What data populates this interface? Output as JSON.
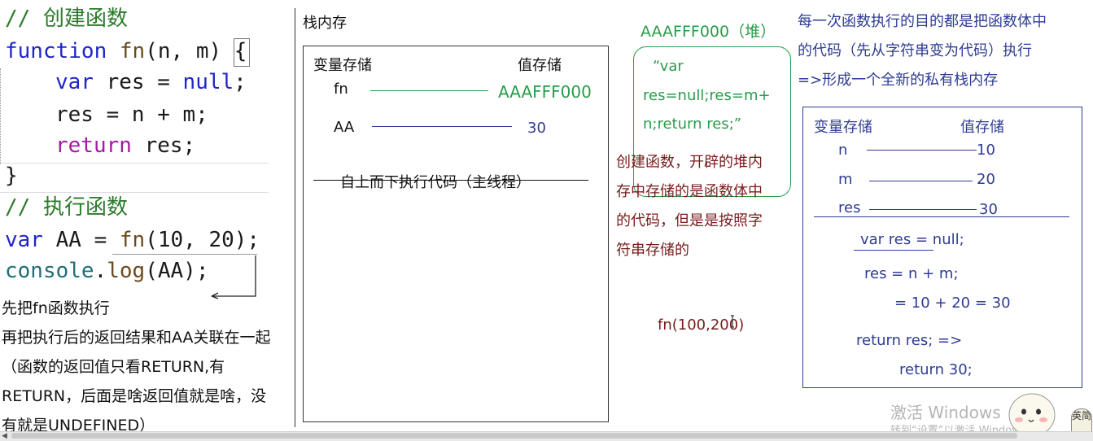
{
  "code": {
    "comment1": "// 创建函数",
    "line_function": [
      "function",
      "fn",
      "(n, m) {"
    ],
    "line_var": [
      "var",
      " res = ",
      "null",
      ";"
    ],
    "line_res": "res = n + m;",
    "line_return": [
      "return",
      " res;"
    ],
    "line_close": "}",
    "comment2": "// 执行函数",
    "line_call": [
      "var",
      " AA = ",
      "fn",
      "(10, 20);"
    ],
    "line_log": [
      "console",
      ".",
      "log",
      "(AA);"
    ]
  },
  "notes": {
    "line1": "先把fn函数执行",
    "line2": "再把执行后的返回结果和AA关联在一起",
    "line3": "（函数的返回值只看RETURN,有",
    "line4": "RETURN，后面是啥返回值就是啥，没",
    "line5": "有就是UNDEFINED）"
  },
  "stack": {
    "title": "栈内存",
    "var_header": "变量存储",
    "val_header": "值存储",
    "rows": [
      {
        "name": "fn",
        "value": "AAAFFF000"
      },
      {
        "name": "AA",
        "value": "30"
      }
    ],
    "thread": "自上而下执行代码（主线程）"
  },
  "heap": {
    "title": "AAAFFF000（堆）",
    "content_line1": "“var",
    "content_line2": "res=null;res=m+",
    "content_line3": "n;return res;”",
    "desc_line1": "创建函数，开辟的堆内",
    "desc_line2": "存中存储的是函数体中",
    "desc_line3": "的代码，但是是按照字",
    "desc_line4": "符串存储的",
    "call": "fn(100,200)"
  },
  "exec": {
    "desc_line1": "每一次函数执行的目的都是把函数体中",
    "desc_line2": "的代码（先从字符串变为代码）执行",
    "desc_line3": "=>形成一个全新的私有栈内存",
    "var_header": "变量存储",
    "val_header": "值存储",
    "rows": [
      {
        "name": "n",
        "value": "10"
      },
      {
        "name": "m",
        "value": "20"
      },
      {
        "name": "res",
        "value": "30"
      }
    ],
    "step1": "var res = null;",
    "step2": "res = n + m;",
    "step3": "= 10 + 20 = 30",
    "step4": "return res;  =>",
    "step5": "return 30;"
  },
  "watermark": {
    "line1": "激活 Windows",
    "line2": "转到“设置”以激活 Windows。"
  },
  "avatar": {
    "label": "英简"
  },
  "colors": {
    "code_keyword": "#1f25c9",
    "comment": "#2c7a2c",
    "heap_green": "#2a9c4a",
    "stack_blue": "#2f3c94",
    "desc_red": "#7a1c1c"
  }
}
